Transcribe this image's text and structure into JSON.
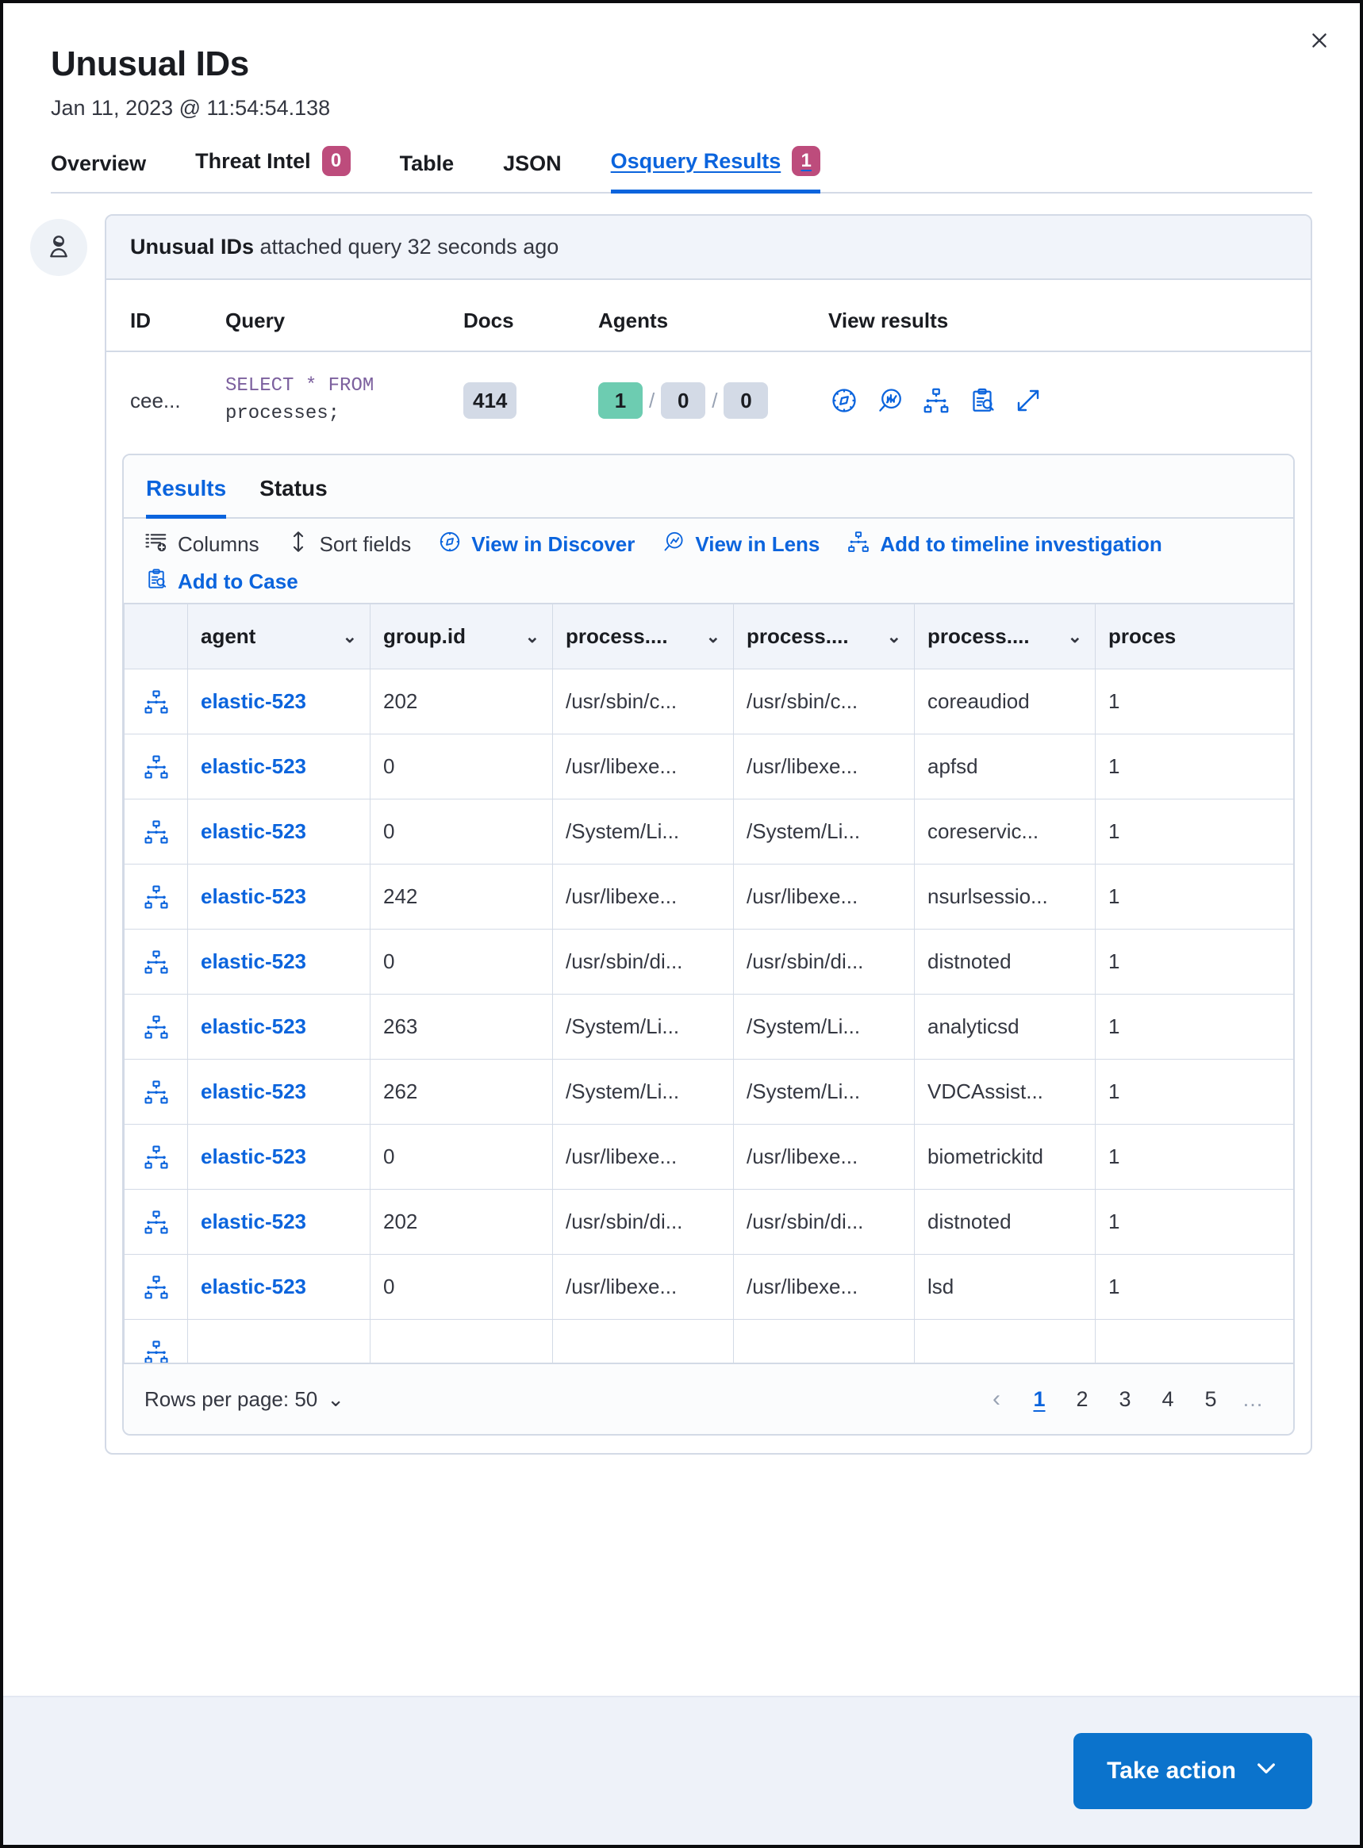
{
  "header": {
    "title": "Unusual IDs",
    "timestamp": "Jan 11, 2023 @ 11:54:54.138",
    "close_label": "Close"
  },
  "tabs": [
    {
      "label": "Overview",
      "badge": null,
      "active": false
    },
    {
      "label": "Threat Intel",
      "badge": "0",
      "active": false
    },
    {
      "label": "Table",
      "badge": null,
      "active": false
    },
    {
      "label": "JSON",
      "badge": null,
      "active": false
    },
    {
      "label": "Osquery Results",
      "badge": "1",
      "active": true
    }
  ],
  "panel": {
    "banner_strong": "Unusual IDs",
    "banner_rest": " attached query 32 seconds ago",
    "columns": [
      "ID",
      "Query",
      "Docs",
      "Agents",
      "View results"
    ],
    "row": {
      "id": "cee...",
      "query_keyword_1": "SELECT",
      "query_star": "*",
      "query_keyword_2": "FROM",
      "query_table": "processes;",
      "docs": "414",
      "agents_success": "1",
      "agents_pending": "0",
      "agents_failed": "0",
      "agents_separator": "/",
      "view_icons": [
        "discover-compass-icon",
        "lens-icon",
        "timeline-icon",
        "add-to-case-icon",
        "expand-icon"
      ]
    }
  },
  "inner_tabs": [
    {
      "label": "Results",
      "active": true
    },
    {
      "label": "Status",
      "active": false
    }
  ],
  "grid_toolbar": [
    {
      "label": "Columns",
      "icon": "columns-icon",
      "link": false
    },
    {
      "label": "Sort fields",
      "icon": "sort-icon",
      "link": false
    },
    {
      "label": "View in Discover",
      "icon": "discover-compass-icon",
      "link": true
    },
    {
      "label": "View in Lens",
      "icon": "lens-icon",
      "link": true
    },
    {
      "label": "Add to timeline investigation",
      "icon": "timeline-icon",
      "link": true
    },
    {
      "label": "Add to Case",
      "icon": "add-to-case-icon",
      "link": true
    }
  ],
  "grid": {
    "columns": [
      {
        "label": "",
        "key": "select"
      },
      {
        "label": "agent",
        "key": "agent"
      },
      {
        "label": "group.id",
        "key": "group_id"
      },
      {
        "label": "process....",
        "key": "p1"
      },
      {
        "label": "process....",
        "key": "p2"
      },
      {
        "label": "process....",
        "key": "p3"
      },
      {
        "label": "proces",
        "key": "p4"
      }
    ],
    "rows": [
      {
        "agent": "elastic-523",
        "group_id": "202",
        "p1": "/usr/sbin/c...",
        "p2": "/usr/sbin/c...",
        "p3": "coreaudiod",
        "p4": "1"
      },
      {
        "agent": "elastic-523",
        "group_id": "0",
        "p1": "/usr/libexe...",
        "p2": "/usr/libexe...",
        "p3": "apfsd",
        "p4": "1"
      },
      {
        "agent": "elastic-523",
        "group_id": "0",
        "p1": "/System/Li...",
        "p2": "/System/Li...",
        "p3": "coreservic...",
        "p4": "1"
      },
      {
        "agent": "elastic-523",
        "group_id": "242",
        "p1": "/usr/libexe...",
        "p2": "/usr/libexe...",
        "p3": "nsurlsessio...",
        "p4": "1"
      },
      {
        "agent": "elastic-523",
        "group_id": "0",
        "p1": "/usr/sbin/di...",
        "p2": "/usr/sbin/di...",
        "p3": "distnoted",
        "p4": "1"
      },
      {
        "agent": "elastic-523",
        "group_id": "263",
        "p1": "/System/Li...",
        "p2": "/System/Li...",
        "p3": "analyticsd",
        "p4": "1"
      },
      {
        "agent": "elastic-523",
        "group_id": "262",
        "p1": "/System/Li...",
        "p2": "/System/Li...",
        "p3": "VDCAssist...",
        "p4": "1"
      },
      {
        "agent": "elastic-523",
        "group_id": "0",
        "p1": "/usr/libexe...",
        "p2": "/usr/libexe...",
        "p3": "biometrickitd",
        "p4": "1"
      },
      {
        "agent": "elastic-523",
        "group_id": "202",
        "p1": "/usr/sbin/di...",
        "p2": "/usr/sbin/di...",
        "p3": "distnoted",
        "p4": "1"
      },
      {
        "agent": "elastic-523",
        "group_id": "0",
        "p1": "/usr/libexe...",
        "p2": "/usr/libexe...",
        "p3": "lsd",
        "p4": "1"
      }
    ]
  },
  "grid_footer": {
    "rows_per_page_label": "Rows per page: 50",
    "pages": [
      "1",
      "2",
      "3",
      "4",
      "5"
    ],
    "active_page": "1",
    "dots": "…",
    "prev_arrow": "‹"
  },
  "footer": {
    "take_action_label": "Take action"
  },
  "colors": {
    "accent_blue": "#0b64dd",
    "badge_pink": "#bd4c7c",
    "success_green": "#6dccb1",
    "button_blue": "#0b73cc",
    "sql_keyword": "#7c609e"
  }
}
